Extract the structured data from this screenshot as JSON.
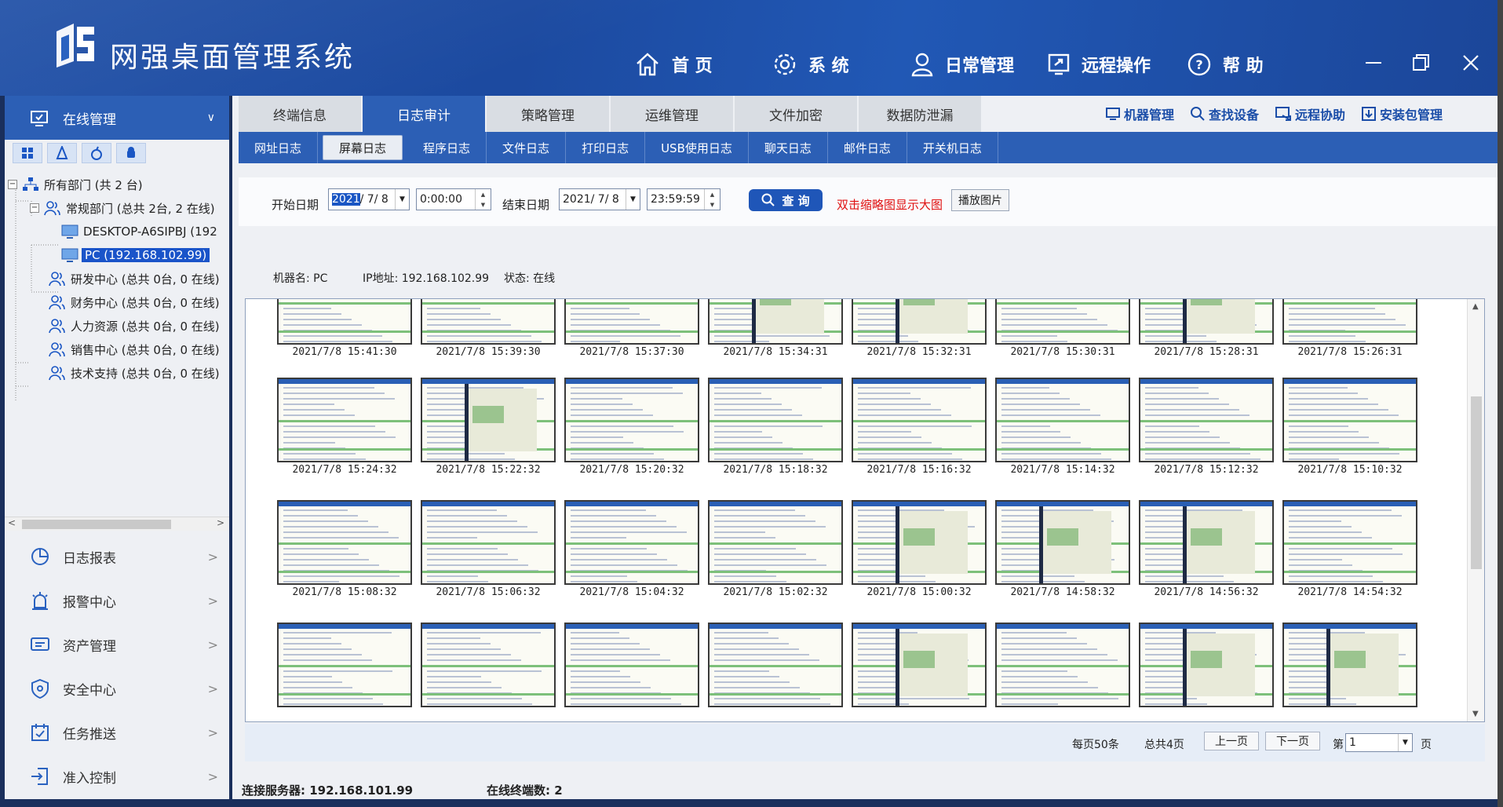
{
  "app": {
    "title": "网强桌面管理系统"
  },
  "nav": [
    {
      "label": "首 页",
      "icon": "home-icon"
    },
    {
      "label": "系 统",
      "icon": "gear-icon"
    },
    {
      "label": "日常管理",
      "icon": "user-icon"
    },
    {
      "label": "远程操作",
      "icon": "remote-screen-icon"
    },
    {
      "label": "帮 助",
      "icon": "help-icon"
    }
  ],
  "sidebar": {
    "header": "在线管理",
    "tree": {
      "root": "所有部门 (共 2 台)",
      "dept1": "常规部门 (总共 2台, 2 在线)",
      "host1": "DESKTOP-A6SIPBJ (192",
      "host2": "PC (192.168.102.99)",
      "dept2": "研发中心 (总共 0台, 0 在线)",
      "dept3": "财务中心 (总共 0台, 0 在线)",
      "dept4": "人力资源 (总共 0台, 0 在线)",
      "dept5": "销售中心 (总共 0台, 0 在线)",
      "dept6": "技术支持 (总共 0台, 0 在线)"
    },
    "menu": [
      {
        "label": "日志报表",
        "icon": "pie-chart-icon"
      },
      {
        "label": "报警中心",
        "icon": "alarm-icon"
      },
      {
        "label": "资产管理",
        "icon": "asset-icon"
      },
      {
        "label": "安全中心",
        "icon": "shield-icon"
      },
      {
        "label": "任务推送",
        "icon": "calendar-icon"
      },
      {
        "label": "准入控制",
        "icon": "login-icon"
      }
    ]
  },
  "tabs": [
    "终端信息",
    "日志审计",
    "策略管理",
    "运维管理",
    "文件加密",
    "数据防泄漏"
  ],
  "tools": [
    "机器管理",
    "查找设备",
    "远程协助",
    "安装包管理"
  ],
  "subtabs": [
    "网址日志",
    "屏幕日志",
    "程序日志",
    "文件日志",
    "打印日志",
    "USB使用日志",
    "聊天日志",
    "邮件日志",
    "开关机日志"
  ],
  "filter": {
    "start_label": "开始日期",
    "start_year": "2021",
    "start_rest": "/ 7/ 8",
    "start_time": "0:00:00",
    "end_label": "结束日期",
    "end_date": "2021/ 7/ 8",
    "end_time": "23:59:59",
    "query": "查 询",
    "hint": "双击缩略图显示大图",
    "play": "播放图片"
  },
  "info": {
    "machine": "机器名: PC",
    "ip": "IP地址: 192.168.102.99",
    "status": "状态: 在线"
  },
  "thumbs": [
    "2021/7/8 15:41:30",
    "2021/7/8 15:39:30",
    "2021/7/8 15:37:30",
    "2021/7/8 15:34:31",
    "2021/7/8 15:32:31",
    "2021/7/8 15:30:31",
    "2021/7/8 15:28:31",
    "2021/7/8 15:26:31",
    "2021/7/8 15:24:32",
    "2021/7/8 15:22:32",
    "2021/7/8 15:20:32",
    "2021/7/8 15:18:32",
    "2021/7/8 15:16:32",
    "2021/7/8 15:14:32",
    "2021/7/8 15:12:32",
    "2021/7/8 15:10:32",
    "2021/7/8 15:08:32",
    "2021/7/8 15:06:32",
    "2021/7/8 15:04:32",
    "2021/7/8 15:02:32",
    "2021/7/8 15:00:32",
    "2021/7/8 14:58:32",
    "2021/7/8 14:56:32",
    "2021/7/8 14:54:32",
    "",
    "",
    "",
    "",
    "",
    "",
    "",
    ""
  ],
  "pager": {
    "per_page": "每页50条",
    "total": "总共4页",
    "prev": "上一页",
    "next": "下一页",
    "page_prefix": "第",
    "page_value": "1",
    "page_suffix": "页"
  },
  "status": {
    "server": "连接服务器: 192.168.101.99",
    "online": "在线终端数: 2"
  }
}
